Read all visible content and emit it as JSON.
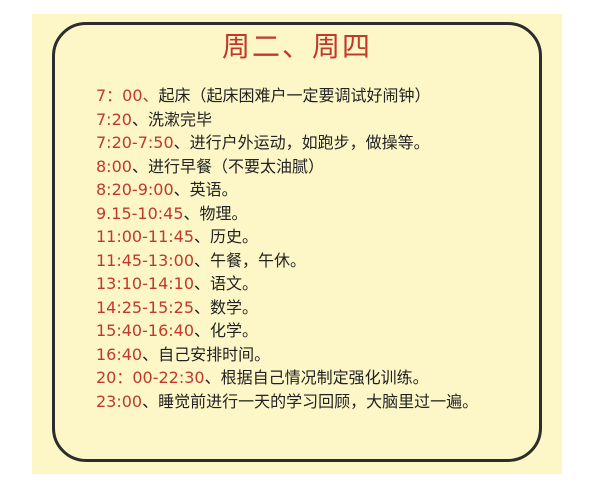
{
  "title": "周二、周四",
  "colors": {
    "background": "#fdf7c8",
    "title": "#c0392b",
    "time": "#c0392b",
    "text": "#222222",
    "border": "#2d2d2d"
  },
  "schedule": [
    {
      "time": "7：00、",
      "text": "起床（起床困难户一定要调试好闹钟）"
    },
    {
      "time": "7:20",
      "text": "、洗漱完毕"
    },
    {
      "time": "7:20-7:50",
      "text": "、进行户外运动，如跑步，做操等。"
    },
    {
      "time": "8:00",
      "text": "、进行早餐（不要太油腻）"
    },
    {
      "time": "8:20-9:00",
      "text": "、英语。"
    },
    {
      "time": "9.15-10:45",
      "text": "、物理。"
    },
    {
      "time": "11:00-11:45",
      "text": "、历史。"
    },
    {
      "time": "11:45-13:00",
      "text": "、午餐，午休。"
    },
    {
      "time": "13:10-14:10",
      "text": "、语文。"
    },
    {
      "time": "14:25-15:25",
      "text": "、数学。"
    },
    {
      "time": "15:40-16:40",
      "text": "、化学。"
    },
    {
      "time": "16:40",
      "text": "、自己安排时间。"
    },
    {
      "time": "20：00-22:30",
      "text": "、根据自己情况制定强化训练。"
    },
    {
      "time": "23:00",
      "text": "、睡觉前进行一天的学习回顾，大脑里过一遍。"
    }
  ]
}
